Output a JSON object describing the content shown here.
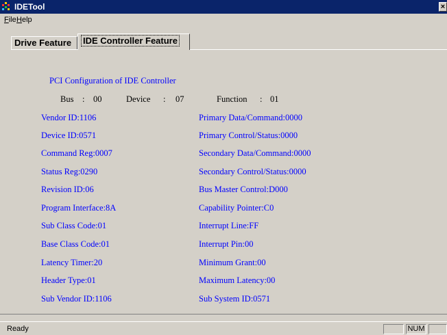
{
  "window": {
    "title": "IDETool",
    "close_label": "×"
  },
  "menu": {
    "items": [
      {
        "label": "File",
        "mnemonic": "F",
        "rest": "ile"
      },
      {
        "label": "Help",
        "mnemonic": "H",
        "rest": "elp"
      }
    ]
  },
  "tabs": [
    {
      "label": "Drive Feature",
      "selected": false
    },
    {
      "label": "IDE Controller Feature",
      "selected": true
    }
  ],
  "pci": {
    "title": "PCI Configuration of IDE Controller",
    "bus_label": "Bus",
    "bus_value": "00",
    "device_label": "Device",
    "device_value": "07",
    "function_label": "Function",
    "function_value": "01"
  },
  "fields_left": [
    "Vendor ID:1106",
    "Device ID:0571",
    "Command Reg:0007",
    "Status Reg:0290",
    "Revision ID:06",
    "Program Interface:8A",
    "Sub Class Code:01",
    "Base Class Code:01",
    "Latency Timer:20",
    "Header Type:01",
    "Sub Vendor ID:1106"
  ],
  "fields_right": [
    "Primary Data/Command:0000",
    "Primary Control/Status:0000",
    "Secondary Data/Command:0000",
    "Secondary Control/Status:0000",
    "Bus Master Control:D000",
    "Capability Pointer:C0",
    "Interrupt Line:FF",
    "Interrupt Pin:00",
    "Minimum Grant:00",
    "Maximum Latency:00",
    "Sub System ID:0571"
  ],
  "status": {
    "text": "Ready",
    "num_indicator": "NUM"
  },
  "colors": {
    "title_bar": "#0a246a",
    "field_text": "#0000ff",
    "face": "#d4d0c8"
  }
}
